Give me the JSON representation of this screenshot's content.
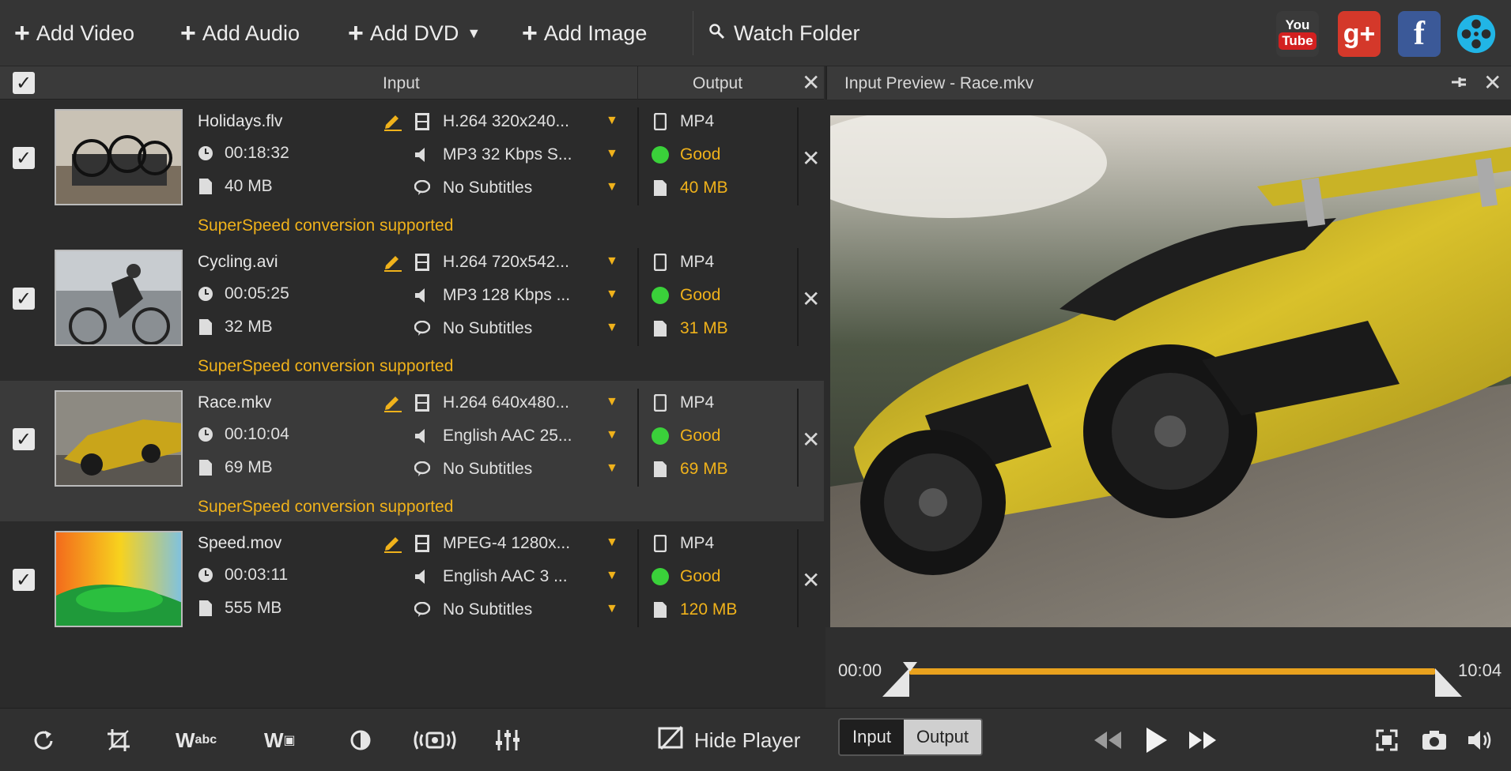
{
  "toolbar": {
    "add_video": "Add Video",
    "add_audio": "Add Audio",
    "add_dvd": "Add DVD",
    "add_image": "Add Image",
    "watch_folder": "Watch Folder",
    "youtube_top": "You",
    "youtube_bottom": "Tube",
    "gplus": "g+",
    "facebook": "f"
  },
  "list_header": {
    "input": "Input",
    "output": "Output"
  },
  "files": [
    {
      "name": "Holidays.flv",
      "duration": "00:18:32",
      "size": "40 MB",
      "video": "H.264 320x240...",
      "audio": "MP3 32 Kbps S...",
      "subtitles": "No Subtitles",
      "out_format": "MP4",
      "quality": "Good",
      "out_size": "40 MB",
      "note": "SuperSpeed conversion supported"
    },
    {
      "name": "Cycling.avi",
      "duration": "00:05:25",
      "size": "32 MB",
      "video": "H.264 720x542...",
      "audio": "MP3 128 Kbps ...",
      "subtitles": "No Subtitles",
      "out_format": "MP4",
      "quality": "Good",
      "out_size": "31 MB",
      "note": "SuperSpeed conversion supported"
    },
    {
      "name": "Race.mkv",
      "duration": "00:10:04",
      "size": "69 MB",
      "video": "H.264 640x480...",
      "audio": "English AAC 25...",
      "subtitles": "No Subtitles",
      "out_format": "MP4",
      "quality": "Good",
      "out_size": "69 MB",
      "note": "SuperSpeed conversion supported"
    },
    {
      "name": "Speed.mov",
      "duration": "00:03:11",
      "size": "555 MB",
      "video": "MPEG-4 1280x...",
      "audio": "English AAC 3 ...",
      "subtitles": "No Subtitles",
      "out_format": "MP4",
      "quality": "Good",
      "out_size": "120 MB",
      "note": ""
    }
  ],
  "preview": {
    "title": "Input Preview - Race.mkv",
    "time_start": "00:00",
    "time_end": "10:04"
  },
  "bottom": {
    "hide_player": "Hide Player",
    "tab_input": "Input",
    "tab_output": "Output"
  },
  "colors": {
    "accent": "#f0b21b",
    "good": "#3ad13a",
    "bg": "#2b2b2b"
  }
}
